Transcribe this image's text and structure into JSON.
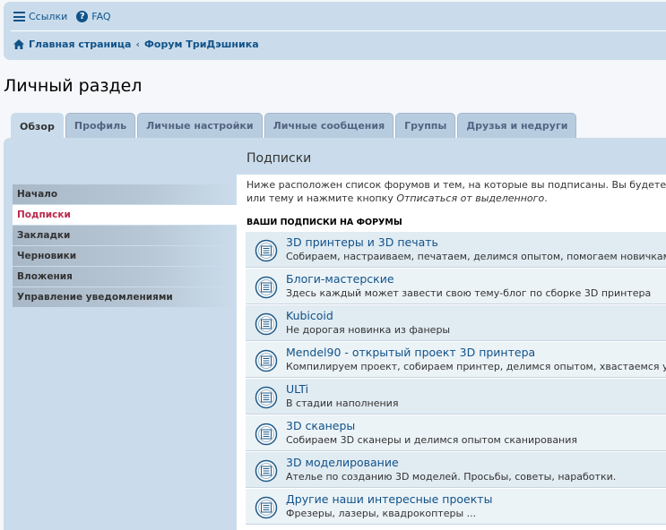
{
  "header": {
    "quicklinks": [
      {
        "label": "Ссылки",
        "icon": "hamburger-icon"
      },
      {
        "label": "FAQ",
        "icon": "question-circle-icon"
      }
    ],
    "breadcrumbs": [
      {
        "label": "Главная страница",
        "icon": "home-icon"
      },
      {
        "label": "Форум ТриДэшника"
      }
    ]
  },
  "page": {
    "title": "Личный раздел"
  },
  "tabs": [
    {
      "label": "Обзор",
      "active": true
    },
    {
      "label": "Профиль"
    },
    {
      "label": "Личные настройки"
    },
    {
      "label": "Личные сообщения"
    },
    {
      "label": "Группы"
    },
    {
      "label": "Друзья и недруги"
    }
  ],
  "sidebar": {
    "items": [
      {
        "label": "Начало"
      },
      {
        "label": "Подписки",
        "active": true
      },
      {
        "label": "Закладки"
      },
      {
        "label": "Черновики"
      },
      {
        "label": "Вложения"
      },
      {
        "label": "Управление уведомлениями"
      }
    ]
  },
  "main": {
    "section_title": "Подписки",
    "intro_line1": "Ниже расположен список форумов и тем, на которые вы подписаны. Вы будете",
    "intro_line2_prefix": "или тему и нажмите кнопку ",
    "intro_line2_em": "Отписаться от выделенного",
    "intro_line2_suffix": ".",
    "list_header": "Ваши подписки на форумы",
    "forums": [
      {
        "name": "3D принтеры и 3D печать",
        "desc": "Собираем, настраиваем, печатаем, делимся опытом, помогаем новичкам"
      },
      {
        "name": "Блоги-мастерские",
        "desc": "Здесь каждый может завести свою тему-блог по сборке 3D принтера"
      },
      {
        "name": "Kubicoid",
        "desc": "Не дорогая новинка из фанеры"
      },
      {
        "name": "Mendel90 - открытый проект 3D принтера",
        "desc": "Компилируем проект, собираем принтер, делимся опытом, хвастаемся у"
      },
      {
        "name": "ULTi",
        "desc": "В стадии наполнения"
      },
      {
        "name": "3D сканеры",
        "desc": "Собираем 3D сканеры и делимся опытом сканирования"
      },
      {
        "name": "3D моделирование",
        "desc": "Ателье по созданию 3D моделей. Просьбы, советы, наработки."
      },
      {
        "name": "Другие наши интересные проекты",
        "desc": "Фрезеры, лазеры, квадрокоптеры ..."
      }
    ]
  },
  "colors": {
    "accent": "#105289",
    "active_menu": "#bc2a4d",
    "panel": "#cadceb"
  }
}
